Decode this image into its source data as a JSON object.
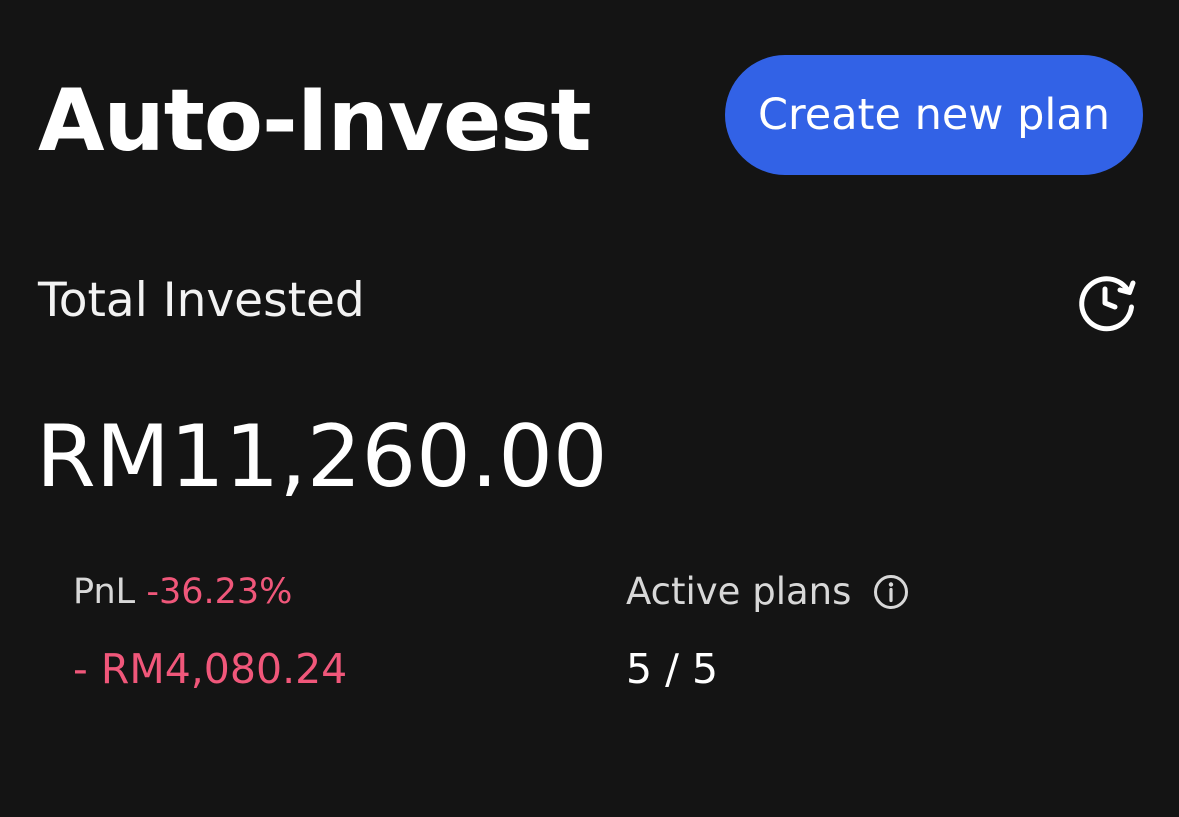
{
  "header": {
    "title": "Auto-Invest",
    "create_button_label": "Create new plan"
  },
  "summary": {
    "total_label": "Total Invested",
    "total_amount": "RM11,260.00",
    "history_icon": "history-clock-icon"
  },
  "stats": {
    "pnl_label": "PnL",
    "pnl_percent": "-36.23%",
    "pnl_amount": "- RM4,080.24",
    "active_label": "Active plans",
    "active_value": "5 / 5",
    "info_icon": "info-icon"
  },
  "colors": {
    "background": "#141414",
    "accent": "#3262e6",
    "negative": "#f0577a",
    "text": "#ffffff",
    "muted": "#d8d8d8"
  }
}
